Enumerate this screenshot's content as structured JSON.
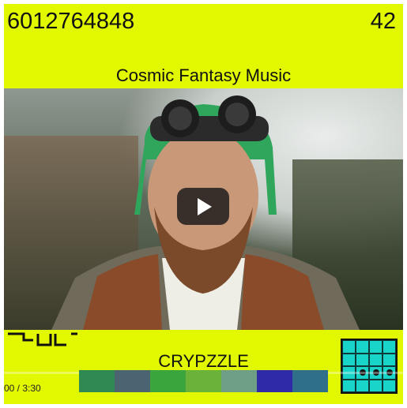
{
  "header": {
    "number": "6012764848",
    "count": "42"
  },
  "video": {
    "title": "Cosmic Fantasy Music",
    "play_label": "Play"
  },
  "footer": {
    "brand": "CRYPZZLE",
    "time": "00 / 3:30",
    "swatches": [
      "#2e8a52",
      "#4b6472",
      "#3aa53c",
      "#6bb23a",
      "#6f9e86",
      "#2f2aa8",
      "#2f6f8a"
    ],
    "qr_cells": [
      0,
      0,
      0,
      0,
      0,
      0,
      0,
      0,
      0,
      1,
      1,
      1,
      0,
      0,
      0,
      0
    ]
  },
  "colors": {
    "accent": "#e1f801",
    "qr": "#19d4c8"
  }
}
